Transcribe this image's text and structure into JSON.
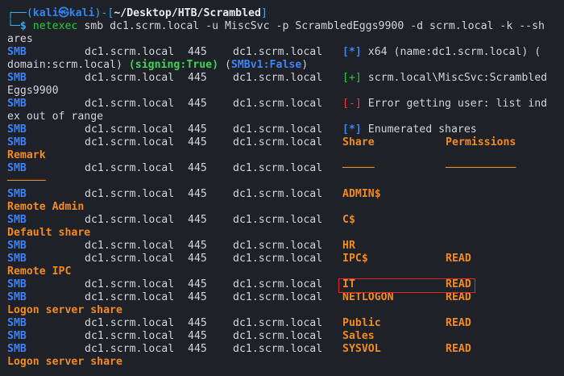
{
  "prompt": {
    "frame_open": "┌──(",
    "user": "kali㉿kali",
    "frame_mid": ")-[",
    "path": "~/Desktop/HTB/Scrambled",
    "frame_close": "]",
    "frame_bottom": "└─",
    "dollar": "$",
    "cmd_name": "netexec",
    "cmd_args_line1": " smb dc1.scrm.local -u MiscSvc -p ScrambledEggs9900 -d scrm.local -k --sh",
    "cmd_args_line2": "ares"
  },
  "smb_label": "SMB",
  "host": "dc1.scrm.local",
  "port": "445",
  "info_lines": {
    "l1_tag": "[*]",
    "l1_text": " x64 (name:dc1.scrm.local) (",
    "l1_wrap_a": "domain:scrm.local) ",
    "l1_signing": "(signing:True)",
    "l1_space": " ",
    "l1_smbv1_open": "(",
    "l1_smbv1": "SMBv1:False",
    "l1_smbv1_close": ")",
    "l2_tag": "[+]",
    "l2_text": " scrm.local\\MiscSvc:Scrambled",
    "l2_wrap": "Eggs9900",
    "l3_tag": "[-]",
    "l3_text": " Error getting user: list ind",
    "l3_wrap": "ex out of range",
    "l4_tag": "[*]",
    "l4_text": " Enumerated shares"
  },
  "share_table": {
    "header_share": "Share",
    "header_permissions": "Permissions",
    "header_remark": "Remark",
    "rule_share": "─────",
    "rule_permissions": "───────────",
    "rule_remark": "──────",
    "rows": [
      {
        "share": "ADMIN$",
        "perm": "",
        "remark": "Remote Admin"
      },
      {
        "share": "C$",
        "perm": "",
        "remark": "Default share"
      },
      {
        "share": "HR",
        "perm": "",
        "remark": ""
      },
      {
        "share": "IPC$",
        "perm": "READ",
        "remark": "Remote IPC"
      },
      {
        "share": "IT",
        "perm": "READ",
        "remark": ""
      },
      {
        "share": "NETLOGON",
        "perm": "READ",
        "remark": "Logon server share"
      },
      {
        "share": "Public",
        "perm": "READ",
        "remark": ""
      },
      {
        "share": "Sales",
        "perm": "",
        "remark": ""
      },
      {
        "share": "SYSVOL",
        "perm": "READ",
        "remark": "Logon server share"
      }
    ]
  },
  "colors": {
    "background": "#1e2128",
    "smb_blue": "#3f82f5",
    "share_orange": "#f18b21",
    "success_green": "#27c93f",
    "error_red": "#e8413a",
    "highlight_red": "#e3262a"
  }
}
